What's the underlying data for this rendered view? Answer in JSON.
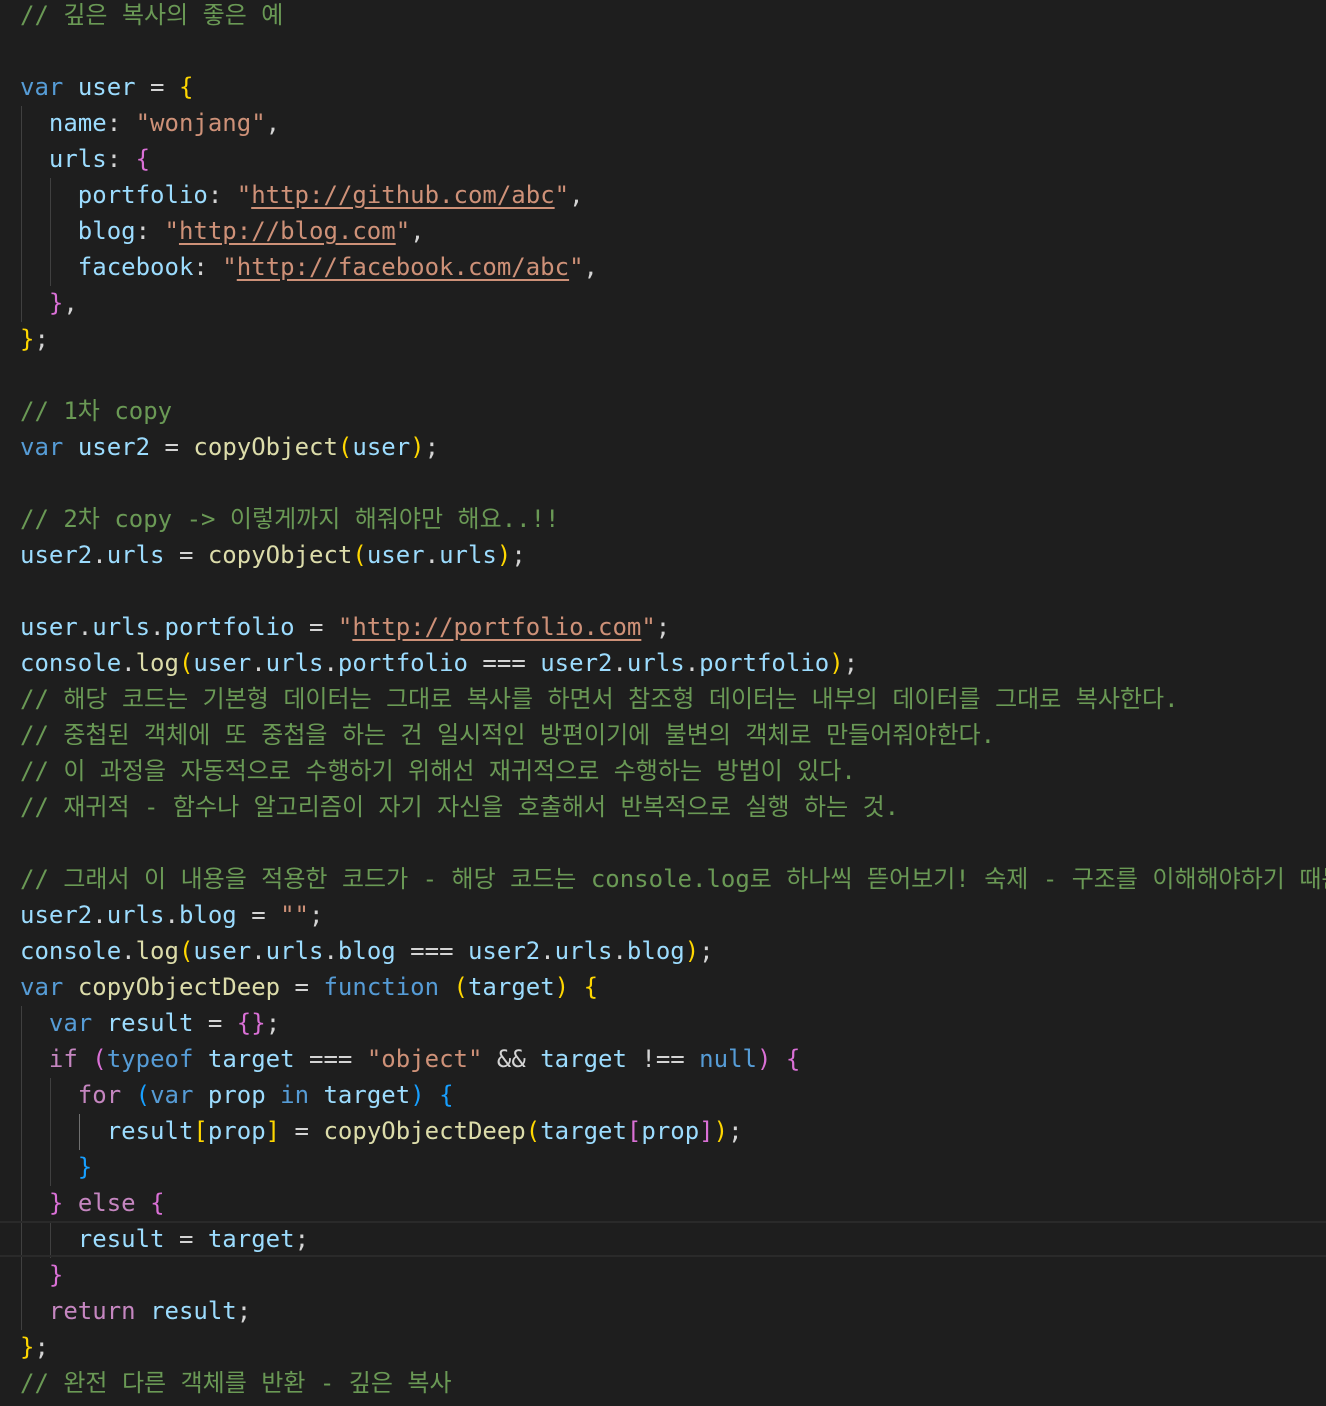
{
  "editor": {
    "theme": "dark",
    "colors": {
      "background": "#1e1e1e",
      "comment": "#6a9955",
      "keyword": "#569cd6",
      "control": "#c586c0",
      "variable": "#9cdcfe",
      "function": "#dcdcaa",
      "string": "#ce9178",
      "bracket1": "#ffd700",
      "bracket2": "#da70d6",
      "bracket3": "#179fff"
    },
    "lines": [
      [
        [
          "c",
          "// 깊은 복사의 좋은 예"
        ]
      ],
      [],
      [
        [
          "k",
          "var"
        ],
        [
          "p",
          " "
        ],
        [
          "v",
          "user"
        ],
        [
          "p",
          " = "
        ],
        [
          "b1",
          "{"
        ]
      ],
      [
        [
          "p",
          "  "
        ],
        [
          "v",
          "name"
        ],
        [
          "p",
          ": "
        ],
        [
          "s",
          "\"wonjang\""
        ],
        [
          "p",
          ","
        ]
      ],
      [
        [
          "p",
          "  "
        ],
        [
          "v",
          "urls"
        ],
        [
          "p",
          ": "
        ],
        [
          "b2",
          "{"
        ]
      ],
      [
        [
          "p",
          "    "
        ],
        [
          "v",
          "portfolio"
        ],
        [
          "p",
          ": "
        ],
        [
          "s",
          "\""
        ],
        [
          "u",
          "http://github.com/abc"
        ],
        [
          "s",
          "\""
        ],
        [
          "p",
          ","
        ]
      ],
      [
        [
          "p",
          "    "
        ],
        [
          "v",
          "blog"
        ],
        [
          "p",
          ": "
        ],
        [
          "s",
          "\""
        ],
        [
          "u",
          "http://blog.com"
        ],
        [
          "s",
          "\""
        ],
        [
          "p",
          ","
        ]
      ],
      [
        [
          "p",
          "    "
        ],
        [
          "v",
          "facebook"
        ],
        [
          "p",
          ": "
        ],
        [
          "s",
          "\""
        ],
        [
          "u",
          "http://facebook.com/abc"
        ],
        [
          "s",
          "\""
        ],
        [
          "p",
          ","
        ]
      ],
      [
        [
          "p",
          "  "
        ],
        [
          "b2",
          "}"
        ],
        [
          "p",
          ","
        ]
      ],
      [
        [
          "b1",
          "}"
        ],
        [
          "p",
          ";"
        ]
      ],
      [],
      [
        [
          "c",
          "// 1차 copy"
        ]
      ],
      [
        [
          "k",
          "var"
        ],
        [
          "p",
          " "
        ],
        [
          "v",
          "user2"
        ],
        [
          "p",
          " = "
        ],
        [
          "f",
          "copyObject"
        ],
        [
          "b1",
          "("
        ],
        [
          "v",
          "user"
        ],
        [
          "b1",
          ")"
        ],
        [
          "p",
          ";"
        ]
      ],
      [],
      [
        [
          "c",
          "// 2차 copy -> 이렇게까지 해줘야만 해요..!!"
        ]
      ],
      [
        [
          "v",
          "user2"
        ],
        [
          "p",
          "."
        ],
        [
          "v",
          "urls"
        ],
        [
          "p",
          " = "
        ],
        [
          "f",
          "copyObject"
        ],
        [
          "b1",
          "("
        ],
        [
          "v",
          "user"
        ],
        [
          "p",
          "."
        ],
        [
          "v",
          "urls"
        ],
        [
          "b1",
          ")"
        ],
        [
          "p",
          ";"
        ]
      ],
      [],
      [
        [
          "v",
          "user"
        ],
        [
          "p",
          "."
        ],
        [
          "v",
          "urls"
        ],
        [
          "p",
          "."
        ],
        [
          "v",
          "portfolio"
        ],
        [
          "p",
          " = "
        ],
        [
          "s",
          "\""
        ],
        [
          "u",
          "http://portfolio.com"
        ],
        [
          "s",
          "\""
        ],
        [
          "p",
          ";"
        ]
      ],
      [
        [
          "v",
          "console"
        ],
        [
          "p",
          "."
        ],
        [
          "f",
          "log"
        ],
        [
          "b1",
          "("
        ],
        [
          "v",
          "user"
        ],
        [
          "p",
          "."
        ],
        [
          "v",
          "urls"
        ],
        [
          "p",
          "."
        ],
        [
          "v",
          "portfolio"
        ],
        [
          "p",
          " === "
        ],
        [
          "v",
          "user2"
        ],
        [
          "p",
          "."
        ],
        [
          "v",
          "urls"
        ],
        [
          "p",
          "."
        ],
        [
          "v",
          "portfolio"
        ],
        [
          "b1",
          ")"
        ],
        [
          "p",
          ";"
        ]
      ],
      [
        [
          "c",
          "// 해당 코드는 기본형 데이터는 그대로 복사를 하면서 참조형 데이터는 내부의 데이터를 그대로 복사한다."
        ]
      ],
      [
        [
          "c",
          "// 중첩된 객체에 또 중첩을 하는 건 일시적인 방편이기에 불변의 객체로 만들어줘야한다."
        ]
      ],
      [
        [
          "c",
          "// 이 과정을 자동적으로 수행하기 위해선 재귀적으로 수행하는 방법이 있다."
        ]
      ],
      [
        [
          "c",
          "// 재귀적 - 함수나 알고리즘이 자기 자신을 호출해서 반복적으로 실행 하는 것."
        ]
      ],
      [],
      [
        [
          "c",
          "// 그래서 이 내용을 적용한 코드가 - 해당 코드는 console.log로 하나씩 뜯어보기! 숙제 - 구조를 이해해야하기 때문"
        ]
      ],
      [
        [
          "v",
          "user2"
        ],
        [
          "p",
          "."
        ],
        [
          "v",
          "urls"
        ],
        [
          "p",
          "."
        ],
        [
          "v",
          "blog"
        ],
        [
          "p",
          " = "
        ],
        [
          "s",
          "\"\""
        ],
        [
          "p",
          ";"
        ]
      ],
      [
        [
          "v",
          "console"
        ],
        [
          "p",
          "."
        ],
        [
          "f",
          "log"
        ],
        [
          "b1",
          "("
        ],
        [
          "v",
          "user"
        ],
        [
          "p",
          "."
        ],
        [
          "v",
          "urls"
        ],
        [
          "p",
          "."
        ],
        [
          "v",
          "blog"
        ],
        [
          "p",
          " === "
        ],
        [
          "v",
          "user2"
        ],
        [
          "p",
          "."
        ],
        [
          "v",
          "urls"
        ],
        [
          "p",
          "."
        ],
        [
          "v",
          "blog"
        ],
        [
          "b1",
          ")"
        ],
        [
          "p",
          ";"
        ]
      ],
      [
        [
          "k",
          "var"
        ],
        [
          "p",
          " "
        ],
        [
          "f",
          "copyObjectDeep"
        ],
        [
          "p",
          " = "
        ],
        [
          "k",
          "function"
        ],
        [
          "p",
          " "
        ],
        [
          "b1",
          "("
        ],
        [
          "v",
          "target"
        ],
        [
          "b1",
          ")"
        ],
        [
          "p",
          " "
        ],
        [
          "b1",
          "{"
        ]
      ],
      [
        [
          "p",
          "  "
        ],
        [
          "k",
          "var"
        ],
        [
          "p",
          " "
        ],
        [
          "v",
          "result"
        ],
        [
          "p",
          " = "
        ],
        [
          "b2",
          "{}"
        ],
        [
          "p",
          ";"
        ]
      ],
      [
        [
          "p",
          "  "
        ],
        [
          "kc",
          "if"
        ],
        [
          "p",
          " "
        ],
        [
          "b2",
          "("
        ],
        [
          "k",
          "typeof"
        ],
        [
          "p",
          " "
        ],
        [
          "v",
          "target"
        ],
        [
          "p",
          " === "
        ],
        [
          "s",
          "\"object\""
        ],
        [
          "p",
          " && "
        ],
        [
          "v",
          "target"
        ],
        [
          "p",
          " !== "
        ],
        [
          "k",
          "null"
        ],
        [
          "b2",
          ")"
        ],
        [
          "p",
          " "
        ],
        [
          "b2",
          "{"
        ]
      ],
      [
        [
          "p",
          "    "
        ],
        [
          "kc",
          "for"
        ],
        [
          "p",
          " "
        ],
        [
          "b3",
          "("
        ],
        [
          "k",
          "var"
        ],
        [
          "p",
          " "
        ],
        [
          "v",
          "prop"
        ],
        [
          "p",
          " "
        ],
        [
          "k",
          "in"
        ],
        [
          "p",
          " "
        ],
        [
          "v",
          "target"
        ],
        [
          "b3",
          ")"
        ],
        [
          "p",
          " "
        ],
        [
          "b3",
          "{"
        ]
      ],
      [
        [
          "p",
          "      "
        ],
        [
          "v",
          "result"
        ],
        [
          "b1",
          "["
        ],
        [
          "v",
          "prop"
        ],
        [
          "b1",
          "]"
        ],
        [
          "p",
          " = "
        ],
        [
          "f",
          "copyObjectDeep"
        ],
        [
          "b1",
          "("
        ],
        [
          "v",
          "target"
        ],
        [
          "b2",
          "["
        ],
        [
          "v",
          "prop"
        ],
        [
          "b2",
          "]"
        ],
        [
          "b1",
          ")"
        ],
        [
          "p",
          ";"
        ]
      ],
      [
        [
          "p",
          "    "
        ],
        [
          "b3",
          "}"
        ]
      ],
      [
        [
          "p",
          "  "
        ],
        [
          "b2",
          "}"
        ],
        [
          "p",
          " "
        ],
        [
          "kc",
          "else"
        ],
        [
          "p",
          " "
        ],
        [
          "b2",
          "{"
        ]
      ],
      [
        [
          "p",
          "    "
        ],
        [
          "v",
          "result"
        ],
        [
          "p",
          " = "
        ],
        [
          "v",
          "target"
        ],
        [
          "p",
          ";"
        ]
      ],
      [
        [
          "p",
          "  "
        ],
        [
          "b2",
          "}"
        ]
      ],
      [
        [
          "p",
          "  "
        ],
        [
          "kc",
          "return"
        ],
        [
          "p",
          " "
        ],
        [
          "v",
          "result"
        ],
        [
          "p",
          ";"
        ]
      ],
      [
        [
          "b1",
          "}"
        ],
        [
          "p",
          ";"
        ]
      ],
      [
        [
          "c",
          "// 완전 다른 객체를 반환 - 깊은 복사"
        ]
      ]
    ]
  }
}
